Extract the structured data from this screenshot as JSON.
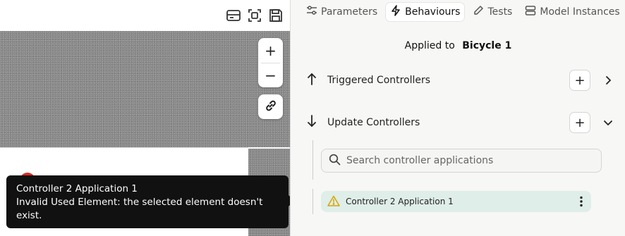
{
  "viewport": {
    "toolbar_icons": [
      "card-icon",
      "focus-frame-icon",
      "save-icon"
    ],
    "zoom_in_label": "+",
    "zoom_out_label": "−"
  },
  "tooltip": {
    "title": "Controller 2 Application 1",
    "message": "Invalid Used Element: the selected element doesn't exist."
  },
  "tabs": [
    {
      "label": "Parameters",
      "icon": "sliders-icon",
      "active": false
    },
    {
      "label": "Behaviours",
      "icon": "lightning-icon",
      "active": true
    },
    {
      "label": "Tests",
      "icon": "pencil-icon",
      "active": false
    },
    {
      "label": "Model Instances",
      "icon": "stack-icon",
      "active": false
    }
  ],
  "applied": {
    "prefix": "Applied to",
    "target": "Bicycle 1"
  },
  "sections": {
    "triggered": {
      "label": "Triggered Controllers",
      "add_label": "+"
    },
    "update": {
      "label": "Update Controllers",
      "add_label": "+"
    }
  },
  "search": {
    "placeholder": "Search controller applications",
    "value": ""
  },
  "applications": [
    {
      "label": "Controller 2 Application 1",
      "status": "warning"
    }
  ],
  "colors": {
    "accent_item_bg": "#dfeee9",
    "warning": "#d9a400",
    "error_marker": "#d62a2a",
    "tooltip_bg": "#111111"
  }
}
